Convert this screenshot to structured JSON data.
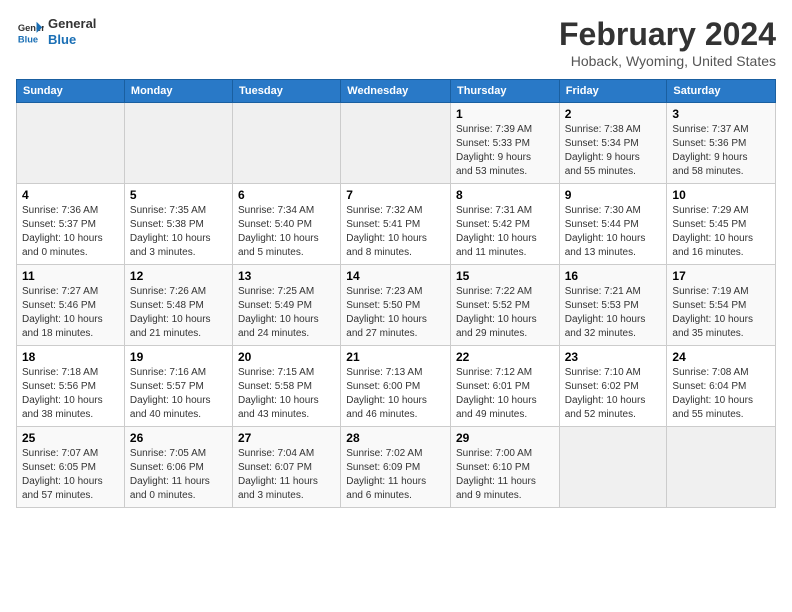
{
  "header": {
    "logo_line1": "General",
    "logo_line2": "Blue",
    "month": "February 2024",
    "location": "Hoback, Wyoming, United States"
  },
  "days_of_week": [
    "Sunday",
    "Monday",
    "Tuesday",
    "Wednesday",
    "Thursday",
    "Friday",
    "Saturday"
  ],
  "weeks": [
    [
      {
        "day": "",
        "content": ""
      },
      {
        "day": "",
        "content": ""
      },
      {
        "day": "",
        "content": ""
      },
      {
        "day": "",
        "content": ""
      },
      {
        "day": "1",
        "content": "Sunrise: 7:39 AM\nSunset: 5:33 PM\nDaylight: 9 hours\nand 53 minutes."
      },
      {
        "day": "2",
        "content": "Sunrise: 7:38 AM\nSunset: 5:34 PM\nDaylight: 9 hours\nand 55 minutes."
      },
      {
        "day": "3",
        "content": "Sunrise: 7:37 AM\nSunset: 5:36 PM\nDaylight: 9 hours\nand 58 minutes."
      }
    ],
    [
      {
        "day": "4",
        "content": "Sunrise: 7:36 AM\nSunset: 5:37 PM\nDaylight: 10 hours\nand 0 minutes."
      },
      {
        "day": "5",
        "content": "Sunrise: 7:35 AM\nSunset: 5:38 PM\nDaylight: 10 hours\nand 3 minutes."
      },
      {
        "day": "6",
        "content": "Sunrise: 7:34 AM\nSunset: 5:40 PM\nDaylight: 10 hours\nand 5 minutes."
      },
      {
        "day": "7",
        "content": "Sunrise: 7:32 AM\nSunset: 5:41 PM\nDaylight: 10 hours\nand 8 minutes."
      },
      {
        "day": "8",
        "content": "Sunrise: 7:31 AM\nSunset: 5:42 PM\nDaylight: 10 hours\nand 11 minutes."
      },
      {
        "day": "9",
        "content": "Sunrise: 7:30 AM\nSunset: 5:44 PM\nDaylight: 10 hours\nand 13 minutes."
      },
      {
        "day": "10",
        "content": "Sunrise: 7:29 AM\nSunset: 5:45 PM\nDaylight: 10 hours\nand 16 minutes."
      }
    ],
    [
      {
        "day": "11",
        "content": "Sunrise: 7:27 AM\nSunset: 5:46 PM\nDaylight: 10 hours\nand 18 minutes."
      },
      {
        "day": "12",
        "content": "Sunrise: 7:26 AM\nSunset: 5:48 PM\nDaylight: 10 hours\nand 21 minutes."
      },
      {
        "day": "13",
        "content": "Sunrise: 7:25 AM\nSunset: 5:49 PM\nDaylight: 10 hours\nand 24 minutes."
      },
      {
        "day": "14",
        "content": "Sunrise: 7:23 AM\nSunset: 5:50 PM\nDaylight: 10 hours\nand 27 minutes."
      },
      {
        "day": "15",
        "content": "Sunrise: 7:22 AM\nSunset: 5:52 PM\nDaylight: 10 hours\nand 29 minutes."
      },
      {
        "day": "16",
        "content": "Sunrise: 7:21 AM\nSunset: 5:53 PM\nDaylight: 10 hours\nand 32 minutes."
      },
      {
        "day": "17",
        "content": "Sunrise: 7:19 AM\nSunset: 5:54 PM\nDaylight: 10 hours\nand 35 minutes."
      }
    ],
    [
      {
        "day": "18",
        "content": "Sunrise: 7:18 AM\nSunset: 5:56 PM\nDaylight: 10 hours\nand 38 minutes."
      },
      {
        "day": "19",
        "content": "Sunrise: 7:16 AM\nSunset: 5:57 PM\nDaylight: 10 hours\nand 40 minutes."
      },
      {
        "day": "20",
        "content": "Sunrise: 7:15 AM\nSunset: 5:58 PM\nDaylight: 10 hours\nand 43 minutes."
      },
      {
        "day": "21",
        "content": "Sunrise: 7:13 AM\nSunset: 6:00 PM\nDaylight: 10 hours\nand 46 minutes."
      },
      {
        "day": "22",
        "content": "Sunrise: 7:12 AM\nSunset: 6:01 PM\nDaylight: 10 hours\nand 49 minutes."
      },
      {
        "day": "23",
        "content": "Sunrise: 7:10 AM\nSunset: 6:02 PM\nDaylight: 10 hours\nand 52 minutes."
      },
      {
        "day": "24",
        "content": "Sunrise: 7:08 AM\nSunset: 6:04 PM\nDaylight: 10 hours\nand 55 minutes."
      }
    ],
    [
      {
        "day": "25",
        "content": "Sunrise: 7:07 AM\nSunset: 6:05 PM\nDaylight: 10 hours\nand 57 minutes."
      },
      {
        "day": "26",
        "content": "Sunrise: 7:05 AM\nSunset: 6:06 PM\nDaylight: 11 hours\nand 0 minutes."
      },
      {
        "day": "27",
        "content": "Sunrise: 7:04 AM\nSunset: 6:07 PM\nDaylight: 11 hours\nand 3 minutes."
      },
      {
        "day": "28",
        "content": "Sunrise: 7:02 AM\nSunset: 6:09 PM\nDaylight: 11 hours\nand 6 minutes."
      },
      {
        "day": "29",
        "content": "Sunrise: 7:00 AM\nSunset: 6:10 PM\nDaylight: 11 hours\nand 9 minutes."
      },
      {
        "day": "",
        "content": ""
      },
      {
        "day": "",
        "content": ""
      }
    ]
  ]
}
